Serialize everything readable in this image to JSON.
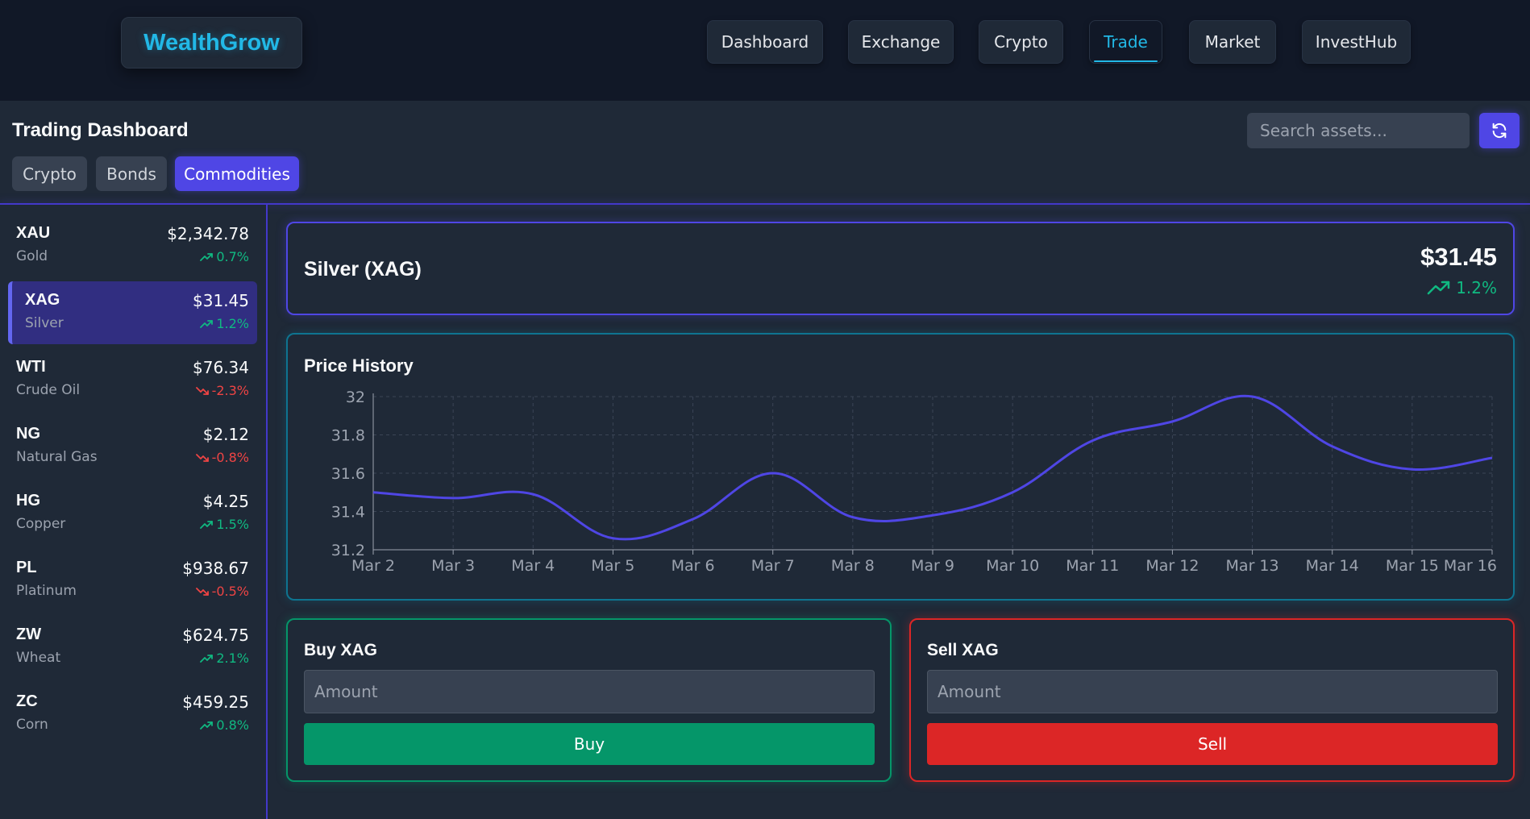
{
  "app": {
    "logo": "WealthGrow"
  },
  "nav": [
    {
      "label": "Dashboard",
      "active": false
    },
    {
      "label": "Exchange",
      "active": false
    },
    {
      "label": "Crypto",
      "active": false
    },
    {
      "label": "Trade",
      "active": true
    },
    {
      "label": "Market",
      "active": false
    },
    {
      "label": "InvestHub",
      "active": false
    }
  ],
  "header": {
    "title": "Trading Dashboard",
    "tabs": [
      {
        "label": "Crypto",
        "active": false
      },
      {
        "label": "Bonds",
        "active": false
      },
      {
        "label": "Commodities",
        "active": true
      }
    ],
    "search_placeholder": "Search assets...",
    "refresh_icon": "refresh-icon"
  },
  "colors": {
    "accent": "#4f46e5",
    "up": "#10b981",
    "down": "#ef4444",
    "brand": "#22b8e6"
  },
  "assets": [
    {
      "symbol": "XAU",
      "name": "Gold",
      "price": "$2,342.78",
      "change": "0.7%",
      "dir": "up",
      "active": false
    },
    {
      "symbol": "XAG",
      "name": "Silver",
      "price": "$31.45",
      "change": "1.2%",
      "dir": "up",
      "active": true
    },
    {
      "symbol": "WTI",
      "name": "Crude Oil",
      "price": "$76.34",
      "change": "-2.3%",
      "dir": "down",
      "active": false
    },
    {
      "symbol": "NG",
      "name": "Natural Gas",
      "price": "$2.12",
      "change": "-0.8%",
      "dir": "down",
      "active": false
    },
    {
      "symbol": "HG",
      "name": "Copper",
      "price": "$4.25",
      "change": "1.5%",
      "dir": "up",
      "active": false
    },
    {
      "symbol": "PL",
      "name": "Platinum",
      "price": "$938.67",
      "change": "-0.5%",
      "dir": "down",
      "active": false
    },
    {
      "symbol": "ZW",
      "name": "Wheat",
      "price": "$624.75",
      "change": "2.1%",
      "dir": "up",
      "active": false
    },
    {
      "symbol": "ZC",
      "name": "Corn",
      "price": "$459.25",
      "change": "0.8%",
      "dir": "up",
      "active": false
    }
  ],
  "quote": {
    "name": "Silver (XAG)",
    "price": "$31.45",
    "change": "1.2%",
    "dir": "up"
  },
  "chart_data": {
    "type": "line",
    "title": "Price History",
    "x": [
      "Mar 2",
      "Mar 3",
      "Mar 4",
      "Mar 5",
      "Mar 6",
      "Mar 7",
      "Mar 8",
      "Mar 9",
      "Mar 10",
      "Mar 11",
      "Mar 12",
      "Mar 13",
      "Mar 14",
      "Mar 15",
      "Mar 16"
    ],
    "series": [
      {
        "values": [
          31.5,
          31.47,
          31.49,
          31.26,
          31.36,
          31.6,
          31.37,
          31.38,
          31.5,
          31.77,
          31.87,
          32.0,
          31.74,
          31.62,
          31.68
        ],
        "color": "#4f46e5"
      }
    ],
    "ylim": [
      31.2,
      32
    ],
    "yticks": [
      31.2,
      31.4,
      31.6,
      31.8,
      32
    ],
    "grid": true,
    "xlabel": "",
    "ylabel": ""
  },
  "buy": {
    "title": "Buy XAG",
    "placeholder": "Amount",
    "button": "Buy"
  },
  "sell": {
    "title": "Sell XAG",
    "placeholder": "Amount",
    "button": "Sell"
  }
}
